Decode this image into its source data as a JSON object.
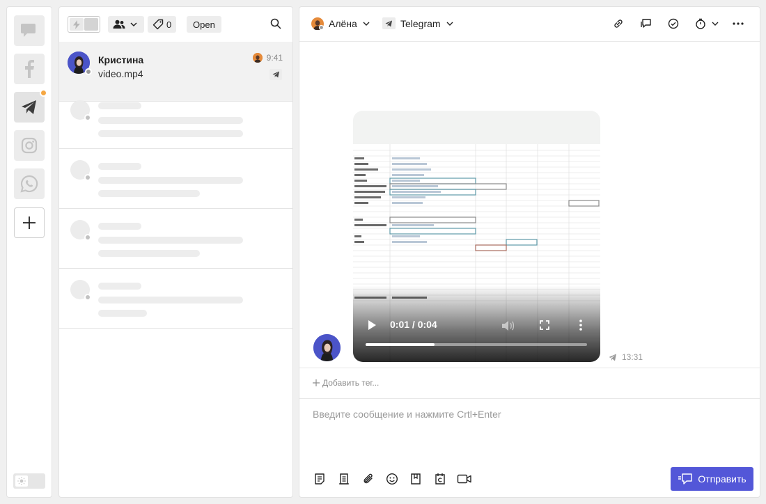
{
  "rail": {
    "channels": [
      {
        "icon": "chat-bubbles-icon"
      },
      {
        "icon": "facebook-icon"
      },
      {
        "icon": "telegram-icon",
        "has_badge": true
      },
      {
        "icon": "instagram-icon"
      },
      {
        "icon": "whatsapp-icon"
      }
    ],
    "add_icon": "plus-icon",
    "theme_icon": "sun-icon"
  },
  "list_toolbar": {
    "tags_count": "0",
    "status_filter": "Open"
  },
  "conversations": [
    {
      "name": "Кристина",
      "preview": "video.mp4",
      "time": "9:41",
      "channel": "telegram"
    }
  ],
  "chat_header": {
    "agent": "Алёна",
    "channel": "Telegram"
  },
  "message": {
    "video": {
      "time_display": "0:01 / 0:04",
      "progress": 0.31
    },
    "time": "13:31"
  },
  "tag_bar": {
    "add_tag_label": "Добавить тег..."
  },
  "composer": {
    "placeholder": "Введите сообщение и нажмите Crtl+Enter",
    "value": "",
    "send_label": "Отправить"
  },
  "colors": {
    "accent": "#5357d8",
    "badge": "#f5a742",
    "avatar_bg": "#4b54c8"
  }
}
